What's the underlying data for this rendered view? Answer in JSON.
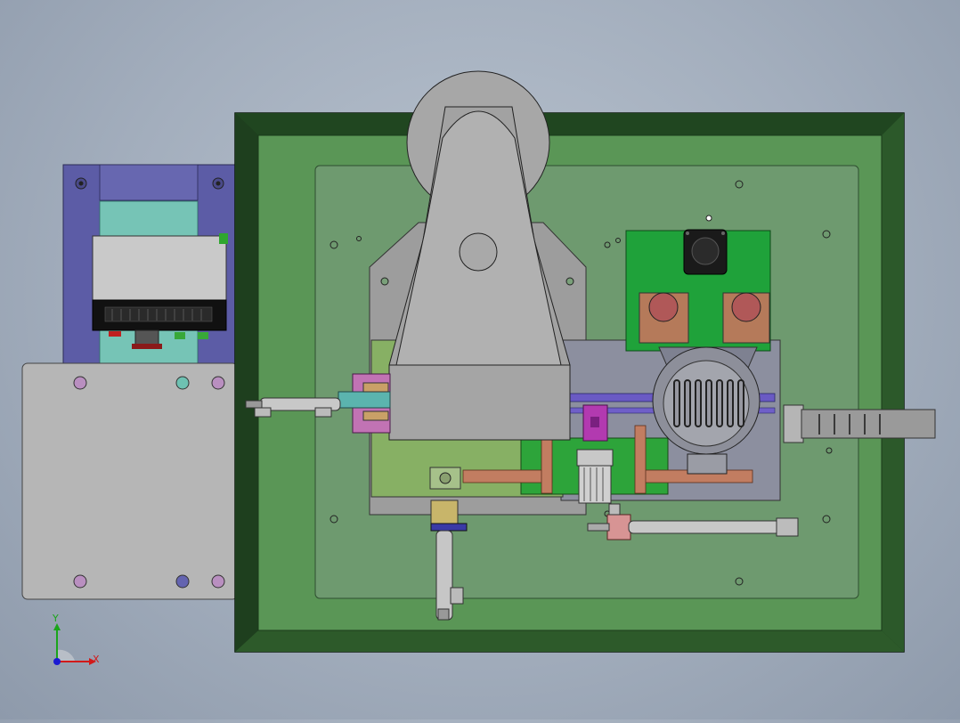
{
  "viewport": {
    "background_top": "#b9c3cf",
    "background_bottom": "#8e9aab"
  },
  "colors": {
    "frame_dark": "#1c3a1c",
    "frame_green": "#3f7a3a",
    "plate_green": "#5e9a5a",
    "inner_plate": "#6f9870",
    "motor_green": "#1fa23a",
    "purple_panel": "#5d5da8",
    "teal": "#73c2b4",
    "grey_part": "#9a9a9a",
    "magenta": "#b03aa8",
    "copper": "#b8765a"
  },
  "triad": {
    "x_label": "X",
    "y_label": "Y",
    "x_color": "#d21a1a",
    "y_color": "#1aa51a",
    "z_color": "#1a1ad2"
  }
}
